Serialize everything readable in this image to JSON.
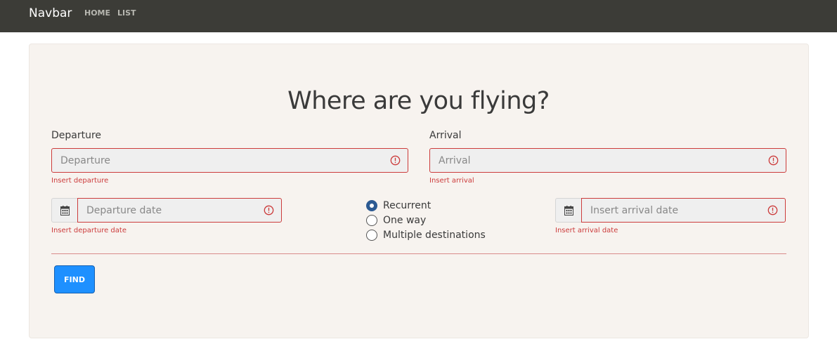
{
  "navbar": {
    "brand": "Navbar",
    "links": [
      "HOME",
      "LIST"
    ]
  },
  "form": {
    "title": "Where are you flying?",
    "departure": {
      "label": "Departure",
      "placeholder": "Departure",
      "value": "",
      "error": "Insert departure"
    },
    "arrival": {
      "label": "Arrival",
      "placeholder": "Arrival",
      "value": "",
      "error": "Insert arrival"
    },
    "departure_date": {
      "placeholder": "Departure date",
      "value": "",
      "error": "Insert departure date"
    },
    "arrival_date": {
      "placeholder": "Insert arrival date",
      "value": "",
      "error": "Insert arrival date"
    },
    "trip_type": {
      "options": [
        "Recurrent",
        "One way",
        "Multiple destinations"
      ],
      "selected": "Recurrent"
    },
    "find_label": "FIND"
  },
  "colors": {
    "navbar_bg": "#3c3c37",
    "card_bg": "#f7f3ef",
    "error": "#cc3b3b",
    "primary": "#1e90ff",
    "radio_selected": "#2c5a92"
  },
  "icons": {
    "error": "alert-circle-icon",
    "calendar": "calendar-icon"
  }
}
